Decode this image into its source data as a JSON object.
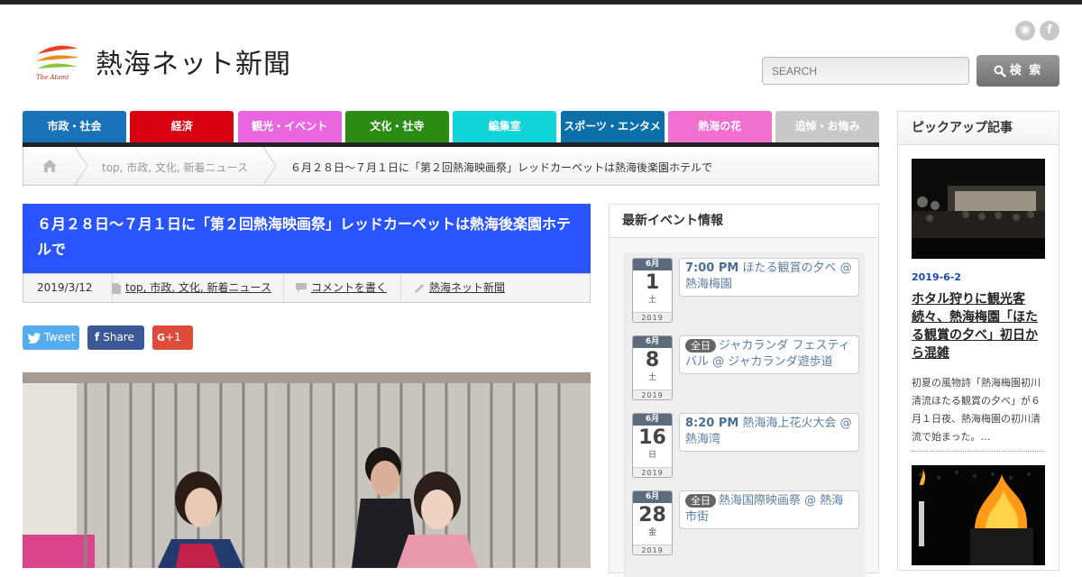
{
  "site": {
    "title": "熱海ネット新聞",
    "logo_tagline": "The Atami"
  },
  "header": {
    "social": [
      {
        "icon": "rss-icon",
        "glyph": "◉"
      },
      {
        "icon": "facebook-icon",
        "glyph": "f"
      }
    ],
    "search_placeholder": "SEARCH",
    "search_button": "検 索"
  },
  "nav": [
    {
      "label": "市政・社会",
      "color": "#1a73b8"
    },
    {
      "label": "経済",
      "color": "#d90011"
    },
    {
      "label": "観光・イベント",
      "color": "#ea66e0"
    },
    {
      "label": "文化・社寺",
      "color": "#2a8c13"
    },
    {
      "label": "編集室",
      "color": "#11d4d8"
    },
    {
      "label": "スポーツ・エンタメ",
      "color": "#0d6fa8"
    },
    {
      "label": "熱海の花",
      "color": "#f06fcf"
    },
    {
      "label": "追悼・お悔み",
      "color": "#c8c8c8"
    }
  ],
  "breadcrumb": {
    "middle": "top, 市政, 文化, 新着ニュース",
    "current": "６月２８日〜７月１日に「第２回熱海映画祭」レッドカーペットは熱海後楽園ホテルで"
  },
  "article": {
    "title": "６月２８日〜７月１日に「第２回熱海映画祭」レッドカーペットは熱海後楽園ホテルで",
    "date": "2019/3/12",
    "categories": "top, 市政, 文化, 新着ニュース",
    "comment": "コメントを書く",
    "author": "熱海ネット新聞"
  },
  "share": {
    "tweet": "Tweet",
    "share": "Share",
    "gplus": "+1",
    "colors": {
      "tweet": "#55acee",
      "share": "#3b5998",
      "gplus": "#dd4b39"
    }
  },
  "events": {
    "heading": "最新イベント情報",
    "items": [
      {
        "month": "6月",
        "day": "1",
        "weekday": "土",
        "year": "2019",
        "time": "7:00 PM",
        "allday": "",
        "text": "ほたる観賞の夕べ @ 熱海梅園"
      },
      {
        "month": "6月",
        "day": "8",
        "weekday": "土",
        "year": "2019",
        "time": "",
        "allday": "全日",
        "text": "ジャカランダ フェスティバル @ ジャカランダ遊歩道"
      },
      {
        "month": "6月",
        "day": "16",
        "weekday": "日",
        "year": "2019",
        "time": "8:20 PM",
        "allday": "",
        "text": "熱海海上花火大会 @ 熱海湾"
      },
      {
        "month": "6月",
        "day": "28",
        "weekday": "金",
        "year": "2019",
        "time": "",
        "allday": "全日",
        "text": "熱海国際映画祭 @ 熱海市街"
      }
    ]
  },
  "pickup": {
    "heading": "ピックアップ記事",
    "date": "2019-6-2",
    "title": "ホタル狩りに観光客続々、熱海梅園「ほたる観賞の夕べ」初日から混雑",
    "excerpt": "初夏の風物詩「熱海梅園初川清流ほたる観賞の夕べ」が６月１日夜、熱海梅園の初川清流で始まった。…"
  }
}
